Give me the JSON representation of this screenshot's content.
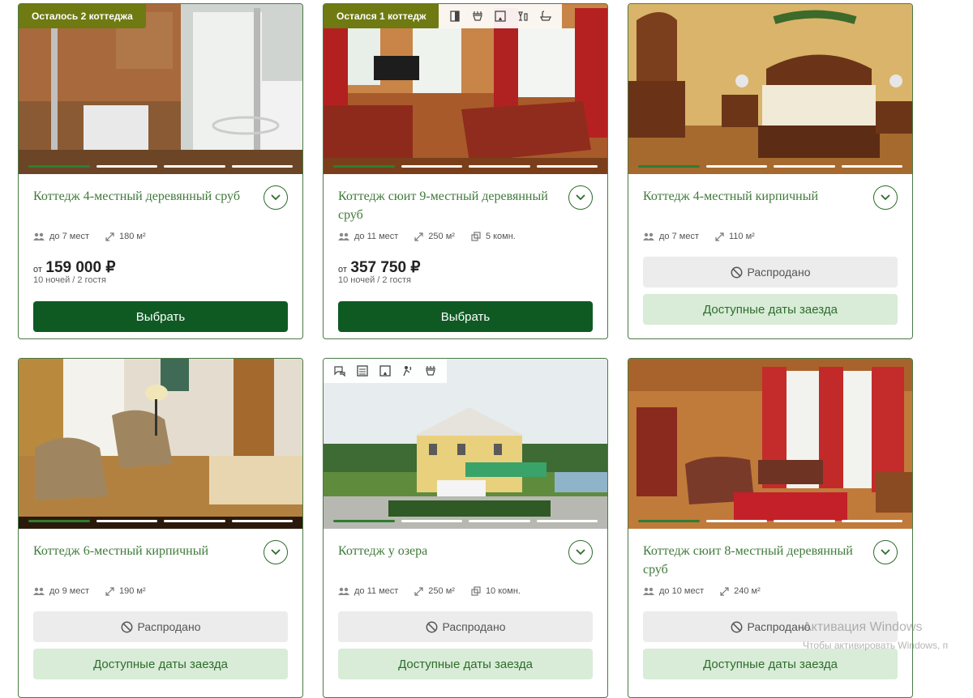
{
  "cards": [
    {
      "badge": "Осталось 2 коттеджа",
      "title": "Коттедж 4-местный деревянный сруб",
      "guests": "до 7 мест",
      "area": "180 м²",
      "price_from": "от",
      "price": "159 000 ₽",
      "price_note": "10 ночей / 2 гостя",
      "button": "Выбрать"
    },
    {
      "badge": "Остался 1 коттедж",
      "title": "Коттедж сюит 9-местный деревянный сруб",
      "guests": "до 11 мест",
      "area": "250 м²",
      "rooms": "5 комн.",
      "price_from": "от",
      "price": "357 750 ₽",
      "price_note": "10 ночей / 2 гостя",
      "button": "Выбрать"
    },
    {
      "title": "Коттедж 4-местный кирпичный",
      "guests": "до 7 мест",
      "area": "110 м²",
      "sold": "Распродано",
      "dates": "Доступные даты заезда"
    },
    {
      "title": "Коттедж 6-местный кирпичный",
      "guests": "до 9 мест",
      "area": "190 м²",
      "sold": "Распродано",
      "dates": "Доступные даты заезда"
    },
    {
      "title": "Коттедж у озера",
      "guests": "до 11 мест",
      "area": "250 м²",
      "rooms": "10 комн.",
      "sold": "Распродано",
      "dates": "Доступные даты заезда"
    },
    {
      "title": "Коттедж сюит 8-местный деревянный сруб",
      "guests": "до 10 мест",
      "area": "240 м²",
      "sold": "Распродано",
      "dates": "Доступные даты заезда"
    }
  ],
  "watermark": {
    "line1": "Активация Windows",
    "line2": "Чтобы активировать Windows, п"
  },
  "colors": {
    "accent": "#0f5a23",
    "title_green": "#3f7a3a",
    "badge": "#6f7a12",
    "dates_bg": "#d8ecd7"
  }
}
